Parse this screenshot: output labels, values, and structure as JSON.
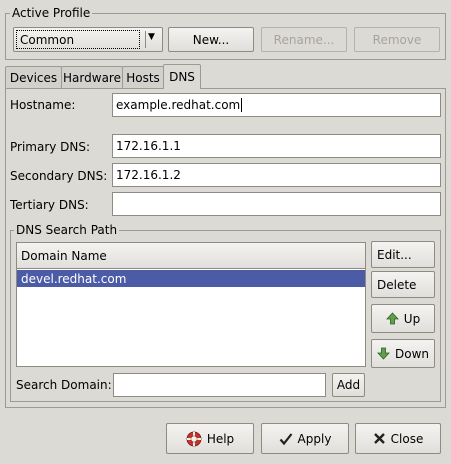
{
  "profile": {
    "section_label": "Active Profile",
    "selected": "Common",
    "new_label": "New...",
    "rename_label": "Rename...",
    "remove_label": "Remove"
  },
  "tabs": [
    {
      "label": "Devices"
    },
    {
      "label": "Hardware"
    },
    {
      "label": "Hosts"
    },
    {
      "label": "DNS"
    }
  ],
  "dns": {
    "hostname_label": "Hostname:",
    "hostname_value": "example.redhat.com",
    "primary_label": "Primary DNS:",
    "primary_value": "172.16.1.1",
    "secondary_label": "Secondary DNS:",
    "secondary_value": "172.16.1.2",
    "tertiary_label": "Tertiary DNS:",
    "tertiary_value": ""
  },
  "search_path": {
    "section_label": "DNS Search Path",
    "column_header": "Domain Name",
    "rows": [
      "devel.redhat.com"
    ],
    "edit_label": "Edit...",
    "delete_label": "Delete",
    "up_label": "Up",
    "down_label": "Down",
    "search_domain_label": "Search Domain:",
    "search_domain_value": "",
    "add_label": "Add"
  },
  "footer": {
    "help_label": "Help",
    "apply_label": "Apply",
    "close_label": "Close"
  },
  "colors": {
    "window_bg": "#dcdad5",
    "selection_bg": "#4b5ba6",
    "selection_text": "#ffffff"
  }
}
